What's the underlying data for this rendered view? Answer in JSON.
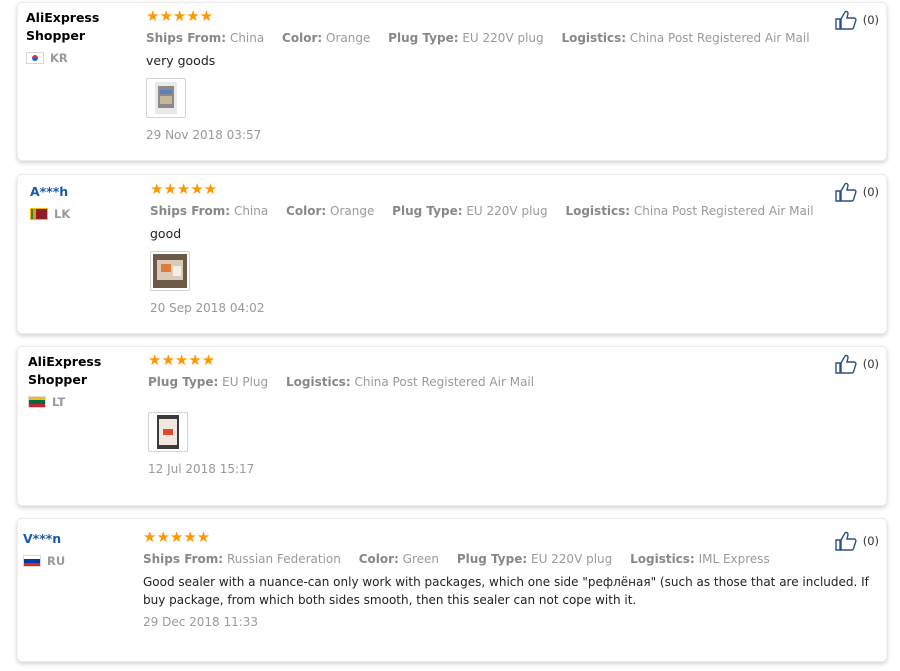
{
  "reviews": [
    {
      "user": "AliExpress Shopper",
      "country": "KR",
      "stars": "★★★★★",
      "attributes": [
        {
          "label": "Ships From:",
          "value": "China"
        },
        {
          "label": "Color:",
          "value": "Orange"
        },
        {
          "label": "Plug Type:",
          "value": "EU 220V plug"
        },
        {
          "label": "Logistics:",
          "value": "China Post Registered Air Mail"
        }
      ],
      "text": "very goods",
      "date": "29 Nov 2018 03:57",
      "likes": "(0)"
    },
    {
      "user": "A***h",
      "country": "LK",
      "stars": "★★★★★",
      "attributes": [
        {
          "label": "Ships From:",
          "value": "China"
        },
        {
          "label": "Color:",
          "value": "Orange"
        },
        {
          "label": "Plug Type:",
          "value": "EU 220V plug"
        },
        {
          "label": "Logistics:",
          "value": "China Post Registered Air Mail"
        }
      ],
      "text": "good",
      "date": "20 Sep 2018 04:02",
      "likes": "(0)"
    },
    {
      "user": "AliExpress Shopper",
      "country": "LT",
      "stars": "★★★★★",
      "attributes": [
        {
          "label": "Plug Type:",
          "value": "EU Plug"
        },
        {
          "label": "Logistics:",
          "value": "China Post Registered Air Mail"
        }
      ],
      "text": "",
      "date": "12 Jul 2018 15:17",
      "likes": "(0)"
    },
    {
      "user": "V***n",
      "country": "RU",
      "stars": "★★★★★",
      "attributes": [
        {
          "label": "Ships From:",
          "value": "Russian Federation"
        },
        {
          "label": "Color:",
          "value": "Green"
        },
        {
          "label": "Plug Type:",
          "value": "EU 220V plug"
        },
        {
          "label": "Logistics:",
          "value": "IML Express"
        }
      ],
      "text": "Good sealer with a nuance-can only work with packages, which one side \"рефлёная\" (such as those that are included. If buy package, from which both sides smooth, then this sealer can not cope with it.",
      "date": "29 Dec 2018 11:33",
      "likes": "(0)"
    }
  ],
  "colors": {
    "star": "#ff9800",
    "link": "#1b5aa8",
    "muted": "#9a9a9a"
  },
  "icons": {
    "like": "thumbs-up-icon",
    "rating": "star-icon"
  }
}
